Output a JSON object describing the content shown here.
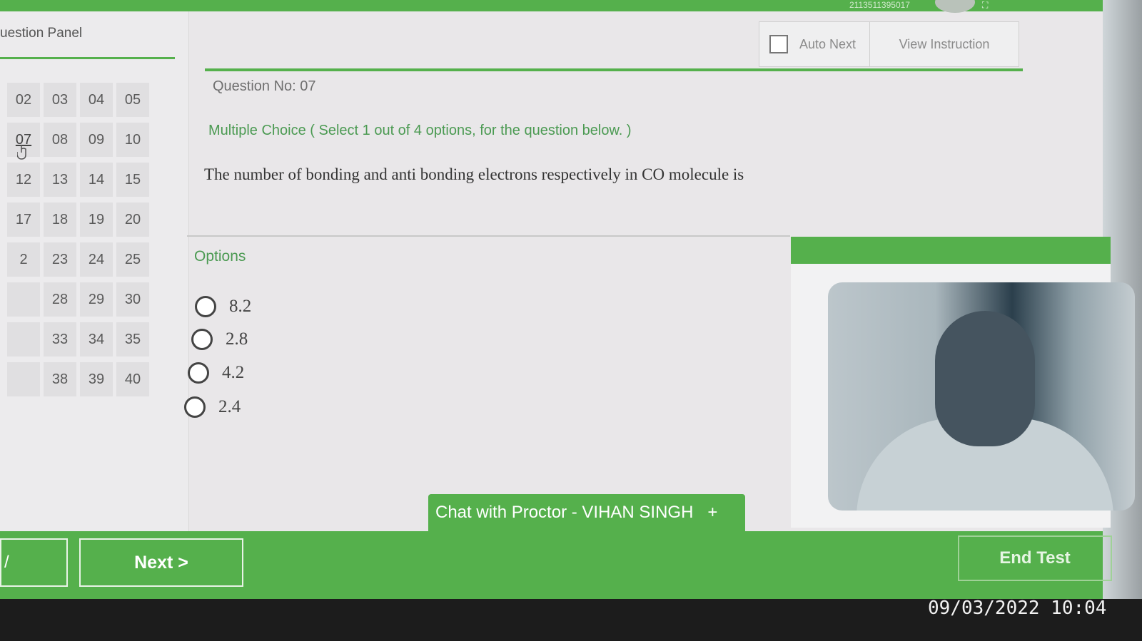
{
  "topbar": {
    "registration_no": "2113511395017"
  },
  "question_panel": {
    "title": "uestion Panel",
    "items": [
      "02",
      "03",
      "04",
      "05",
      "07",
      "08",
      "09",
      "10",
      "12",
      "13",
      "14",
      "15",
      "17",
      "18",
      "19",
      "20",
      "2",
      "23",
      "24",
      "25",
      "",
      "28",
      "29",
      "30",
      "",
      "33",
      "34",
      "35",
      "",
      "38",
      "39",
      "40"
    ],
    "current": "07"
  },
  "toolbar": {
    "auto_next_label": "Auto Next",
    "view_instruction_label": "View Instruction"
  },
  "question": {
    "number_label": "Question No: 07",
    "type_label": "Multiple Choice ( Select 1 out of 4 options, for the question below. )",
    "text": "The number of bonding and anti bonding electrons respectively in CO molecule is"
  },
  "options": {
    "title": "Options",
    "items": [
      "8.2",
      "2.8",
      "4.2",
      "2.4"
    ]
  },
  "chat": {
    "label": "Chat with Proctor - VIHAN SINGH",
    "plus": "+"
  },
  "navigation": {
    "prev_label": "/",
    "next_label": "Next >",
    "end_label": "End Test"
  },
  "photo_timestamp": "09/03/2022 10:04",
  "colors": {
    "accent": "#55b04c",
    "background": "#e9e7e9"
  }
}
